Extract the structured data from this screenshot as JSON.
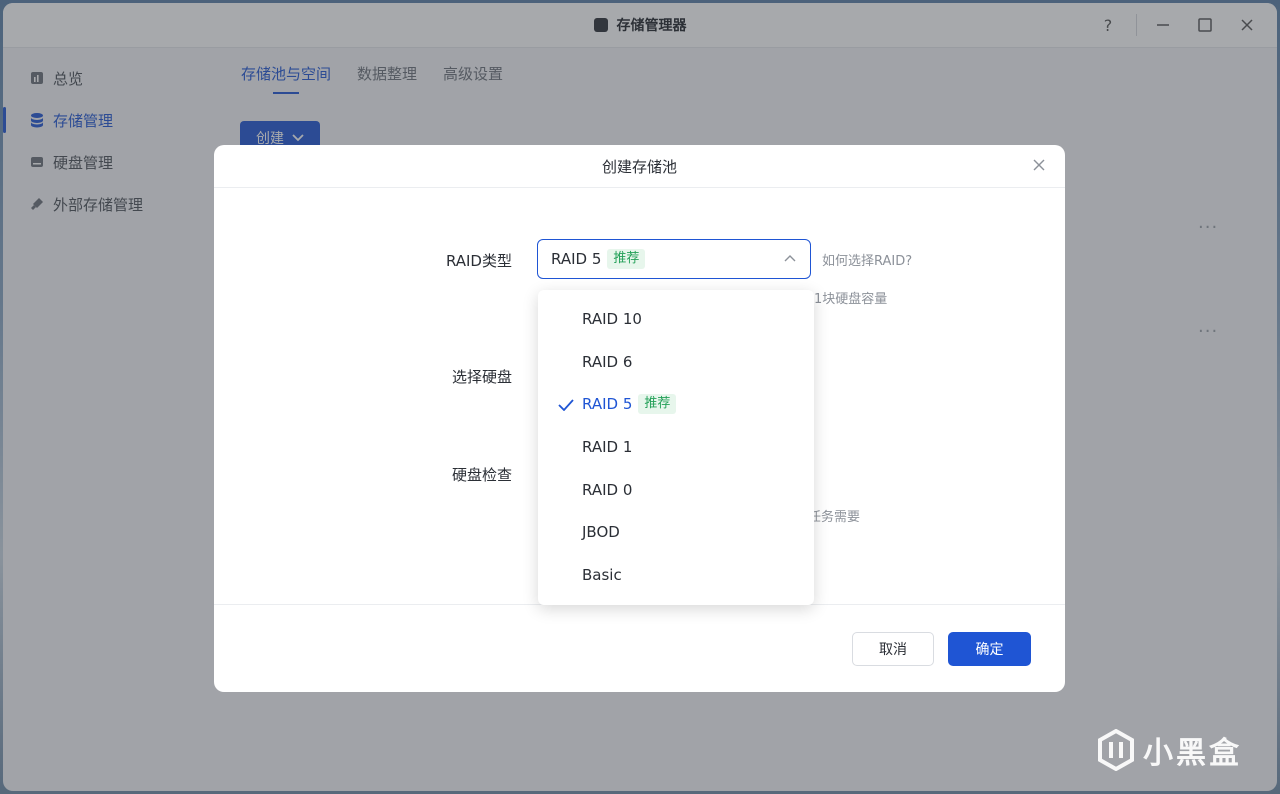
{
  "window": {
    "title": "存储管理器",
    "controls": [
      "help-icon",
      "minimize-icon",
      "maximize-icon",
      "close-icon"
    ]
  },
  "sidebar": {
    "items": [
      {
        "label": "总览",
        "icon": "overview-icon"
      },
      {
        "label": "存储管理",
        "icon": "database-icon",
        "active": true
      },
      {
        "label": "硬盘管理",
        "icon": "disk-icon"
      },
      {
        "label": "外部存储管理",
        "icon": "usb-icon"
      }
    ]
  },
  "main": {
    "tabs": [
      {
        "label": "存储池与空间",
        "active": true
      },
      {
        "label": "数据整理"
      },
      {
        "label": "高级设置"
      }
    ],
    "create_label": "创建"
  },
  "modal": {
    "title": "创建存储池",
    "raid_label": "RAID类型",
    "raid_selected": "RAID 5",
    "recommend_tag": "推荐",
    "help_link": "如何选择RAID?",
    "disk_label": "选择硬盘",
    "check_label": "硬盘检查",
    "hint_capacity": "1块硬盘容量",
    "hint_task": "任务需要",
    "cancel_label": "取消",
    "ok_label": "确定"
  },
  "dropdown": {
    "options": [
      {
        "label": "RAID 10"
      },
      {
        "label": "RAID 6"
      },
      {
        "label": "RAID 5",
        "selected": true,
        "tag": "推荐"
      },
      {
        "label": "RAID 1"
      },
      {
        "label": "RAID 0"
      },
      {
        "label": "JBOD"
      },
      {
        "label": "Basic"
      }
    ]
  },
  "watermark": {
    "text": "小黑盒"
  },
  "colors": {
    "accent": "#1f55d4",
    "tag_bg": "#e7f6ec",
    "tag_text": "#23a058"
  }
}
